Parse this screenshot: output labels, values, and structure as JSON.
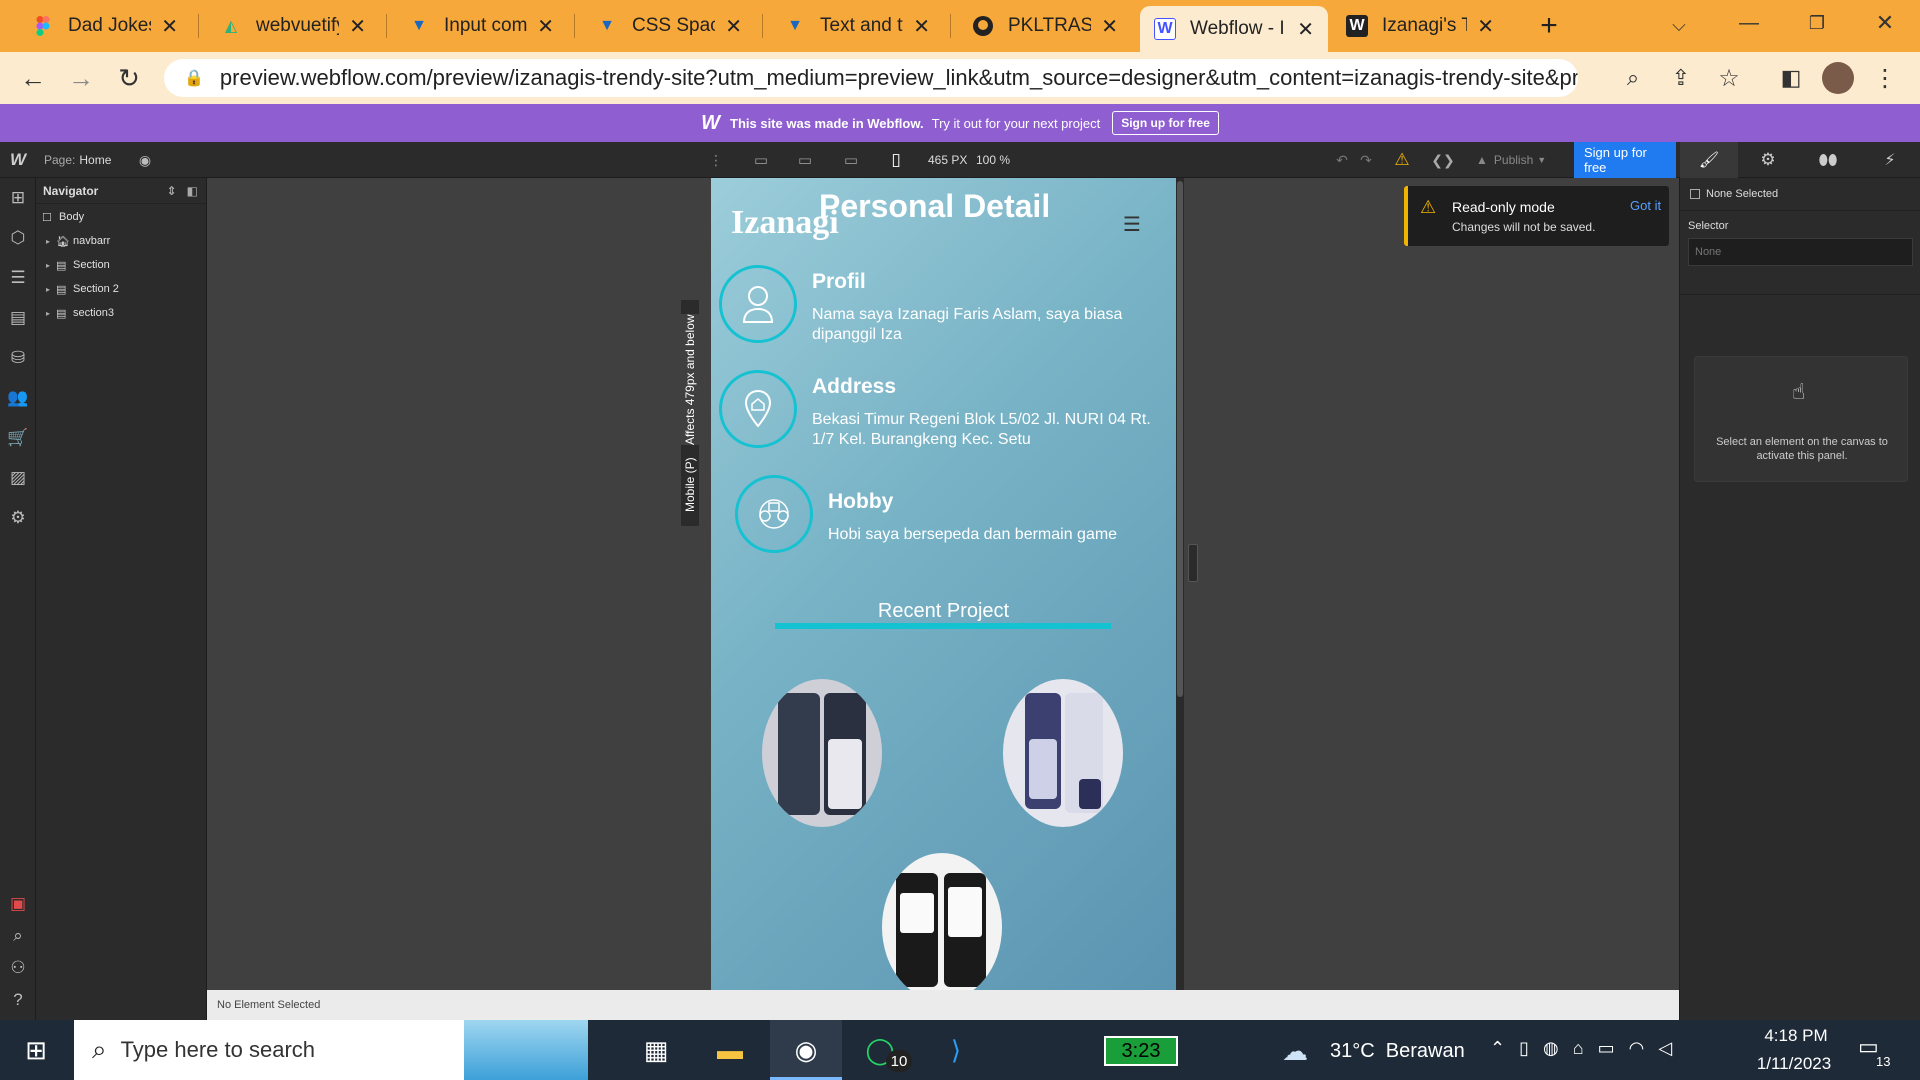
{
  "browser": {
    "tabs": [
      {
        "title": "Dad Jokes -",
        "icon": "figma-icon"
      },
      {
        "title": "webvuetify",
        "icon": "vuetify-icon"
      },
      {
        "title": "Input comp",
        "icon": "vuetify-icon"
      },
      {
        "title": "CSS Spacin",
        "icon": "vuetify-icon"
      },
      {
        "title": "Text and ty",
        "icon": "vuetify-icon"
      },
      {
        "title": "PKLTRASPA",
        "icon": "github-icon"
      },
      {
        "title": "Webflow - I",
        "icon": "webflow-icon",
        "active": true
      },
      {
        "title": "Izanagi's Tr",
        "icon": "webflow-icon"
      }
    ],
    "url": "preview.webflow.com/preview/izanagis-trendy-site?utm_medium=preview_link&utm_source=designer&utm_content=izanagis-trendy-site&preview...",
    "accent": "#f7a83a"
  },
  "banner": {
    "made_in": "This site was made in Webflow.",
    "tryit": "Try it out for your next project",
    "signup": "Sign up for free",
    "color": "#8f5ed0"
  },
  "topbar": {
    "page_label": "Page:",
    "page_name": "Home",
    "width": "465 PX",
    "zoom": "100 %",
    "publish": "Publish",
    "signup": "Sign up for free"
  },
  "navigator": {
    "title": "Navigator",
    "items": [
      "Body",
      "navbarr",
      "Section",
      "Section 2",
      "section3"
    ]
  },
  "breakpoint_label": "Mobile (P)",
  "breakpoint_affects": "Affects 479px and below",
  "site": {
    "logo": "Izanagi",
    "heading": "Personal Detail",
    "rows": [
      {
        "title": "Profil",
        "text": "Nama saya Izanagi Faris Aslam, saya biasa dipanggil Iza"
      },
      {
        "title": "Address",
        "text": "Bekasi Timur Regeni Blok L5/02 Jl. NURI 04 Rt. 1/7 Kel. Burangkeng Kec. Setu"
      },
      {
        "title": "Hobby",
        "text": "Hobi saya bersepeda dan bermain game"
      }
    ],
    "recent_project": "Recent Project",
    "accent": "#14c2d2"
  },
  "toast": {
    "title": "Read-only mode",
    "subtitle": "Changes will not be saved.",
    "action": "Got it"
  },
  "right_panel": {
    "none_selected": "None Selected",
    "selector_label": "Selector",
    "selector_placeholder": "None",
    "hint": "Select an element on the canvas to activate this panel."
  },
  "status": "No Element Selected",
  "taskbar": {
    "search_placeholder": "Type here to search",
    "battery_time": "3:23",
    "whatsapp_badge": "10",
    "weather": "31°C  Berawan",
    "time": "4:18 PM",
    "date": "1/11/2023",
    "notifications": "13"
  }
}
